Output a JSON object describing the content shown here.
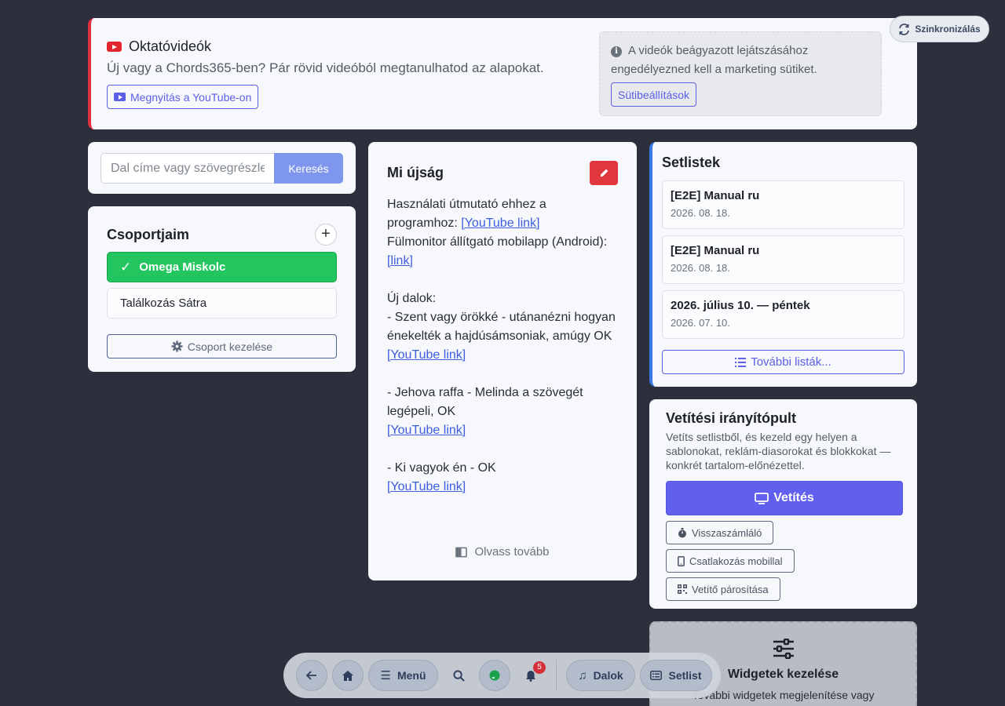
{
  "tutorial": {
    "title": "Oktatóvideók",
    "subtitle": "Új vagy a Chords365-ben? Pár rövid videóból megtanulhatod az alapokat.",
    "open_youtube_label": "Megnyitás a YouTube-on",
    "cookie_notice": "A videók beágyazott lejátszásához engedélyezned kell a marketing sütiket.",
    "cookie_settings_label": "Sütibeállítások",
    "brand_color": "#e0303e"
  },
  "sync": {
    "label": "Szinkronizálás"
  },
  "search": {
    "placeholder": "Dal címe vagy szövegrészlet",
    "button_label": "Keresés"
  },
  "groups": {
    "title": "Csoportjaim",
    "items": [
      {
        "label": "Omega Miskolc",
        "active": true
      },
      {
        "label": "Találkozás Sátra",
        "active": false
      }
    ],
    "manage_label": "Csoport kezelése"
  },
  "news": {
    "title": "Mi újság",
    "line1": "Használati útmutató ehhez a programhoz: ",
    "link1": "[YouTube link]",
    "line2": "Fülmonitor állítgató mobilapp (Android): ",
    "link2": "[link]",
    "line3": "Új dalok:",
    "line4": "- Szent vagy örökké - utánanézni hogyan énekelték a hajdúsámsoniak, amúgy OK",
    "link3": "[YouTube link]",
    "line5": "- Jehova raffa - Melinda a szövegét legépeli, OK",
    "link4": "[YouTube link]",
    "line6": "- Ki vagyok én - OK",
    "link5": "[YouTube link]",
    "read_more_label": "Olvass tovább"
  },
  "setlists": {
    "title": "Setlistek",
    "items": [
      {
        "title": "[E2E] Manual ru",
        "date": "2026. 08. 18."
      },
      {
        "title": "[E2E] Manual ru",
        "date": "2026. 08. 18."
      },
      {
        "title": "2026. július 10. — péntek",
        "date": "2026. 07. 10."
      }
    ],
    "more_label": "További listák..."
  },
  "projection": {
    "title": "Vetítési irányítópult",
    "description": "Vetíts setlistből, és kezeld egy helyen a sablonokat, reklám-diasorokat és blokkokat — konkrét tartalom-előnézettel.",
    "project_label": "Vetítés",
    "countdown_label": "Visszaszámláló",
    "mobile_label": "Csatlakozás mobillal",
    "pairing_label": "Vetítő párosítása"
  },
  "widgets": {
    "title": "Widgetek kezelése",
    "description": "További widgetek megjelenítése vagy"
  },
  "nav": {
    "menu_label": "Menü",
    "notification_count": "5",
    "songs_label": "Dalok",
    "setlist_label": "Setlist"
  }
}
